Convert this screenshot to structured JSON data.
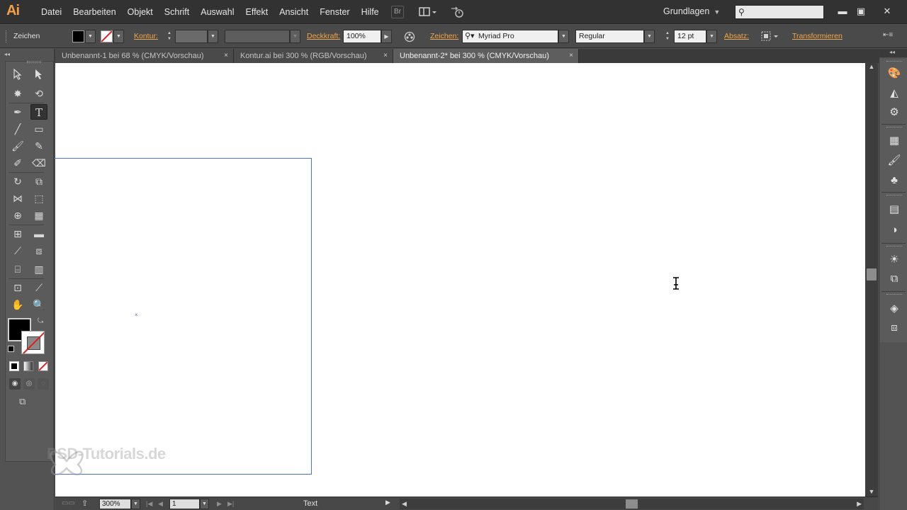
{
  "app": {
    "logo": "Ai"
  },
  "menu": [
    "Datei",
    "Bearbeiten",
    "Objekt",
    "Schrift",
    "Auswahl",
    "Effekt",
    "Ansicht",
    "Fenster",
    "Hilfe"
  ],
  "menubar_icons": {
    "bridge": "Br",
    "arrange": "arrange-documents-icon",
    "sync": "sync-settings-icon"
  },
  "workspace": "Grundlagen",
  "search": {
    "placeholder": "",
    "icon": "search-icon"
  },
  "control": {
    "selection_label": "Zeichen",
    "kontur_label": "Kontur:",
    "deckkraft_label": "Deckkraft:",
    "deckkraft_value": "100%",
    "zeichen_label": "Zeichen:",
    "font": "Myriad Pro",
    "style": "Regular",
    "size": "12 pt",
    "absatz_label": "Absatz:",
    "transformieren_label": "Transformieren"
  },
  "tabs": [
    {
      "label": "Unbenannt-1 bei 68 % (CMYK/Vorschau)",
      "active": false
    },
    {
      "label": "Kontur.ai bei 300 % (RGB/Vorschau)",
      "active": false
    },
    {
      "label": "Unbenannt-2* bei 300 % (CMYK/Vorschau)",
      "active": true
    }
  ],
  "tab_close": "×",
  "status": {
    "zoom": "300%",
    "artboard_nr": "1",
    "tool_name": "Text"
  },
  "watermark": "PSD-Tutorials.de",
  "colors": {
    "accent": "#f0a64a",
    "artboard_border": "#4a74c9",
    "fill": "#000000",
    "stroke": "none"
  }
}
